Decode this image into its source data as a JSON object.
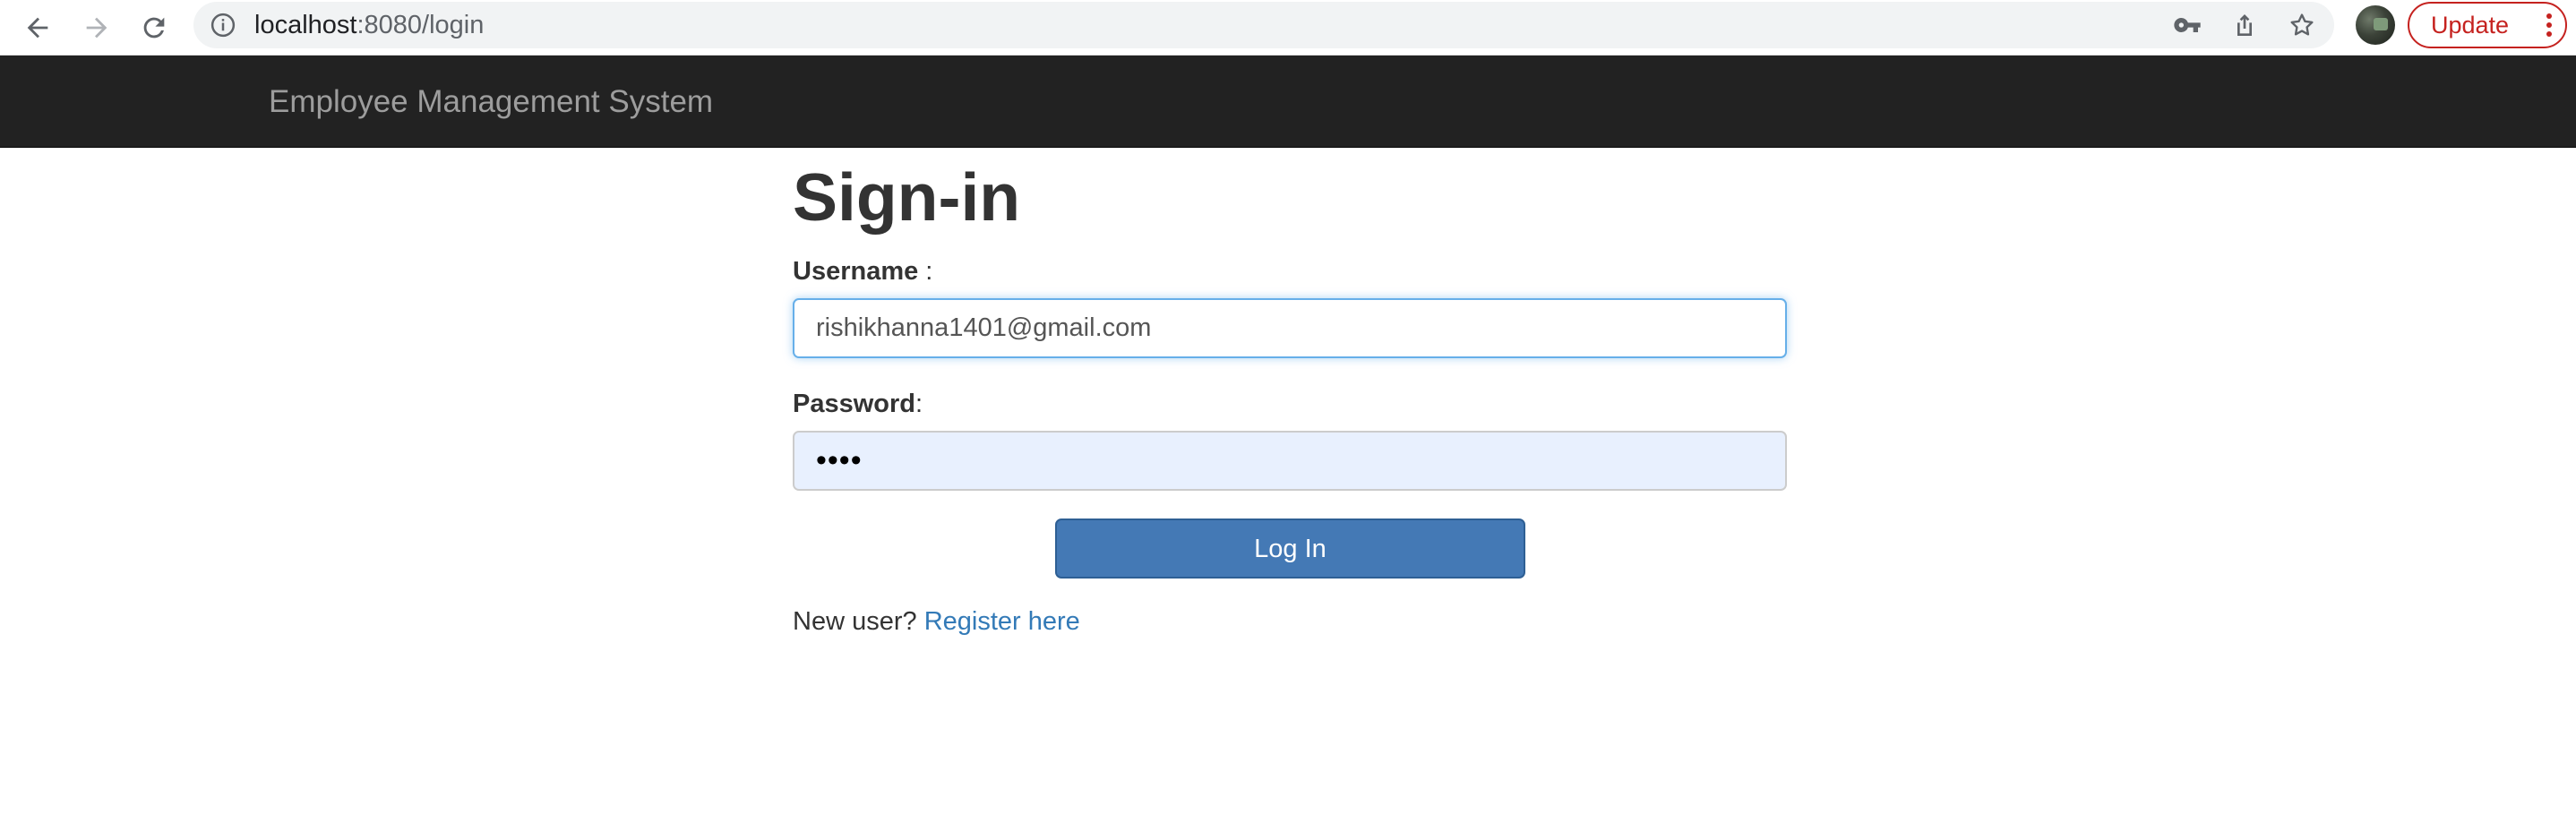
{
  "browser": {
    "url_host": "localhost",
    "url_path": ":8080/login",
    "update_label": "Update",
    "icons": {
      "back": "arrow-left-icon",
      "forward": "arrow-right-icon",
      "reload": "reload-icon",
      "site_info": "info-icon",
      "password": "key-icon",
      "share": "share-icon",
      "bookmark": "star-icon",
      "menu": "vertical-dots-icon"
    },
    "colors": {
      "update": "#c5221f"
    }
  },
  "navbar": {
    "brand": "Employee Management System",
    "background": "#222222"
  },
  "form": {
    "title": "Sign-in",
    "username_label": "Username",
    "username_label_suffix": " :",
    "username_value": "rishikhanna1401@gmail.com",
    "password_label": "Password",
    "password_label_suffix": ":",
    "password_value": "••••",
    "login_button": "Log In",
    "new_user_text": "New user?",
    "register_link": "Register here",
    "colors": {
      "button": "#4479b5",
      "link": "#337ab7"
    }
  }
}
